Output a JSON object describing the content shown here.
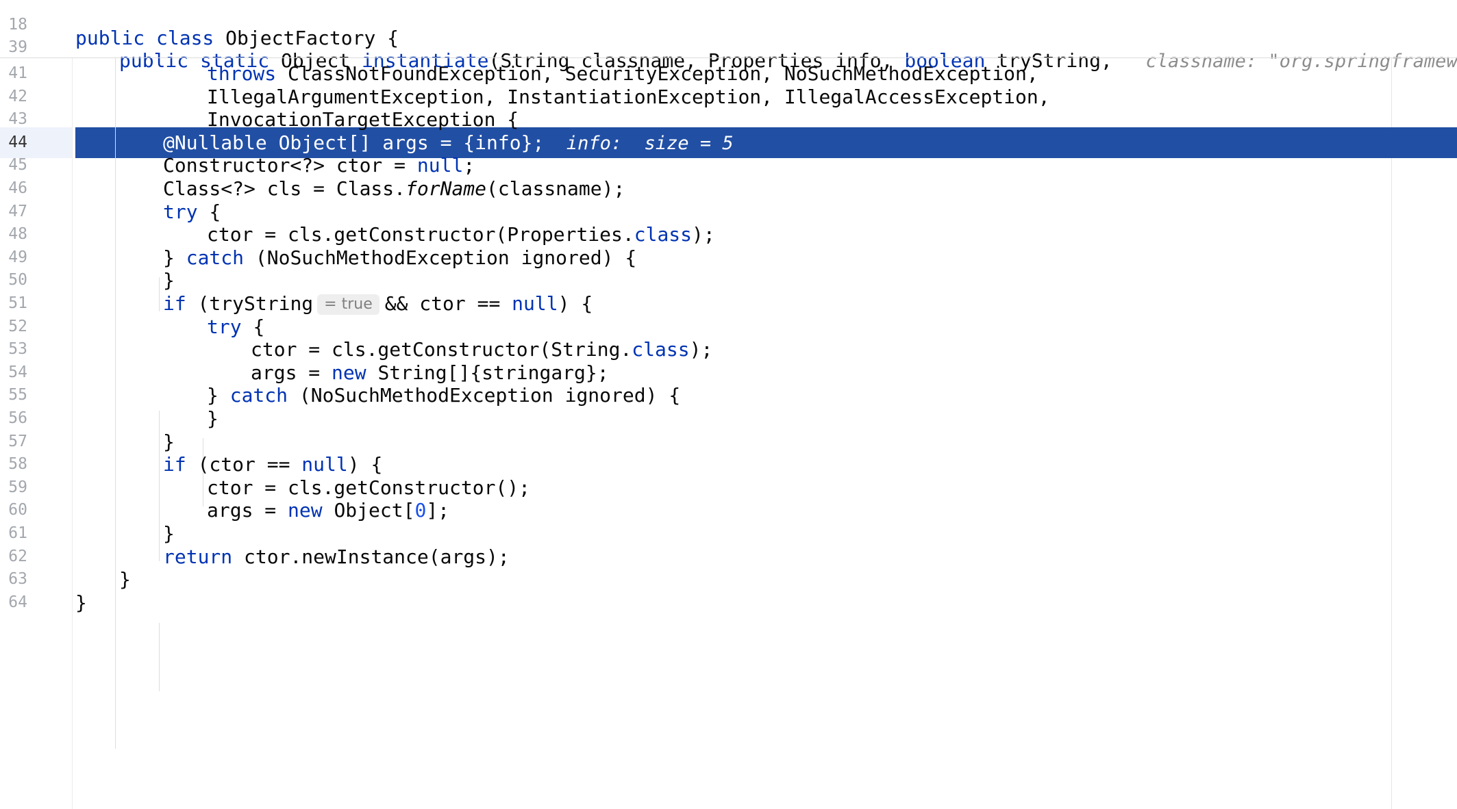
{
  "editor": {
    "sticky": [
      {
        "ln": "18",
        "tokens": [
          {
            "t": "public class ",
            "k": "kw"
          },
          {
            "t": "ObjectFactory {"
          }
        ]
      },
      {
        "ln": "39",
        "tokens": [
          {
            "t": "public static ",
            "k": "kw"
          },
          {
            "t": "Object "
          },
          {
            "t": "instantiate",
            "k": "kw"
          },
          {
            "t": "(String classname, Properties info, "
          },
          {
            "t": "boolean ",
            "k": "kw"
          },
          {
            "t": "tryString,"
          },
          {
            "t": "   classname: \"org.springframework.co",
            "k": "hint"
          }
        ]
      }
    ],
    "lines": [
      {
        "ln": "41",
        "tokens": [
          {
            "t": "throws ",
            "k": "kw"
          },
          {
            "t": "ClassNotFoundException, SecurityException, NoSuchMethodException,"
          }
        ]
      },
      {
        "ln": "42",
        "tokens": [
          {
            "t": "IllegalArgumentException, InstantiationException, IllegalAccessException,"
          }
        ]
      },
      {
        "ln": "43",
        "tokens": [
          {
            "t": "InvocationTargetException {"
          }
        ]
      },
      {
        "ln": "44",
        "tokens": [
          {
            "t": "@Nullable Object[] args = {info};"
          },
          {
            "t": "  info:  size = 5",
            "k": "hint"
          }
        ]
      },
      {
        "ln": "45",
        "tokens": [
          {
            "t": "Constructor<?> ctor = "
          },
          {
            "t": "null",
            "k": "kw"
          },
          {
            "t": ";"
          }
        ]
      },
      {
        "ln": "46",
        "tokens": [
          {
            "t": "Class<?> cls = Class."
          },
          {
            "t": "forName",
            "k": "it"
          },
          {
            "t": "(classname);"
          }
        ]
      },
      {
        "ln": "47",
        "tokens": [
          {
            "t": "try ",
            "k": "kw"
          },
          {
            "t": "{"
          }
        ]
      },
      {
        "ln": "48",
        "tokens": [
          {
            "t": "ctor = cls.getConstructor(Properties."
          },
          {
            "t": "class",
            "k": "kw"
          },
          {
            "t": ");"
          }
        ]
      },
      {
        "ln": "49",
        "tokens": [
          {
            "t": "} "
          },
          {
            "t": "catch ",
            "k": "kw"
          },
          {
            "t": "(NoSuchMethodException ignored) {"
          }
        ]
      },
      {
        "ln": "50",
        "tokens": [
          {
            "t": "}"
          }
        ]
      },
      {
        "ln": "51",
        "tokens": [
          {
            "t": "if ",
            "k": "kw"
          },
          {
            "t": "(tryString"
          },
          {
            "t": "= true",
            "k": "inlay"
          },
          {
            "t": "&& ctor == "
          },
          {
            "t": "null",
            "k": "kw"
          },
          {
            "t": ") {"
          }
        ]
      },
      {
        "ln": "52",
        "tokens": [
          {
            "t": "try ",
            "k": "kw"
          },
          {
            "t": "{"
          }
        ]
      },
      {
        "ln": "53",
        "tokens": [
          {
            "t": "ctor = cls.getConstructor(String."
          },
          {
            "t": "class",
            "k": "kw"
          },
          {
            "t": ");"
          }
        ]
      },
      {
        "ln": "54",
        "tokens": [
          {
            "t": "args = "
          },
          {
            "t": "new ",
            "k": "kw"
          },
          {
            "t": "String[]{stringarg};"
          }
        ]
      },
      {
        "ln": "55",
        "tokens": [
          {
            "t": "} "
          },
          {
            "t": "catch ",
            "k": "kw"
          },
          {
            "t": "(NoSuchMethodException ignored) {"
          }
        ]
      },
      {
        "ln": "56",
        "tokens": [
          {
            "t": "}"
          }
        ]
      },
      {
        "ln": "57",
        "tokens": [
          {
            "t": "}"
          }
        ]
      },
      {
        "ln": "58",
        "tokens": [
          {
            "t": "if ",
            "k": "kw"
          },
          {
            "t": "(ctor == "
          },
          {
            "t": "null",
            "k": "kw"
          },
          {
            "t": ") {"
          }
        ]
      },
      {
        "ln": "59",
        "tokens": [
          {
            "t": "ctor = cls.getConstructor();"
          }
        ]
      },
      {
        "ln": "60",
        "tokens": [
          {
            "t": "args = "
          },
          {
            "t": "new ",
            "k": "kw"
          },
          {
            "t": "Object["
          },
          {
            "t": "0",
            "k": "num"
          },
          {
            "t": "];"
          }
        ]
      },
      {
        "ln": "61",
        "tokens": [
          {
            "t": "}"
          }
        ]
      },
      {
        "ln": "62",
        "tokens": [
          {
            "t": "return ",
            "k": "kw"
          },
          {
            "t": "ctor.newInstance(args);"
          }
        ]
      },
      {
        "ln": "63",
        "tokens": [
          {
            "t": "}"
          }
        ]
      },
      {
        "ln": "64",
        "tokens": [
          {
            "t": "}"
          }
        ]
      }
    ],
    "current_line": "44"
  }
}
